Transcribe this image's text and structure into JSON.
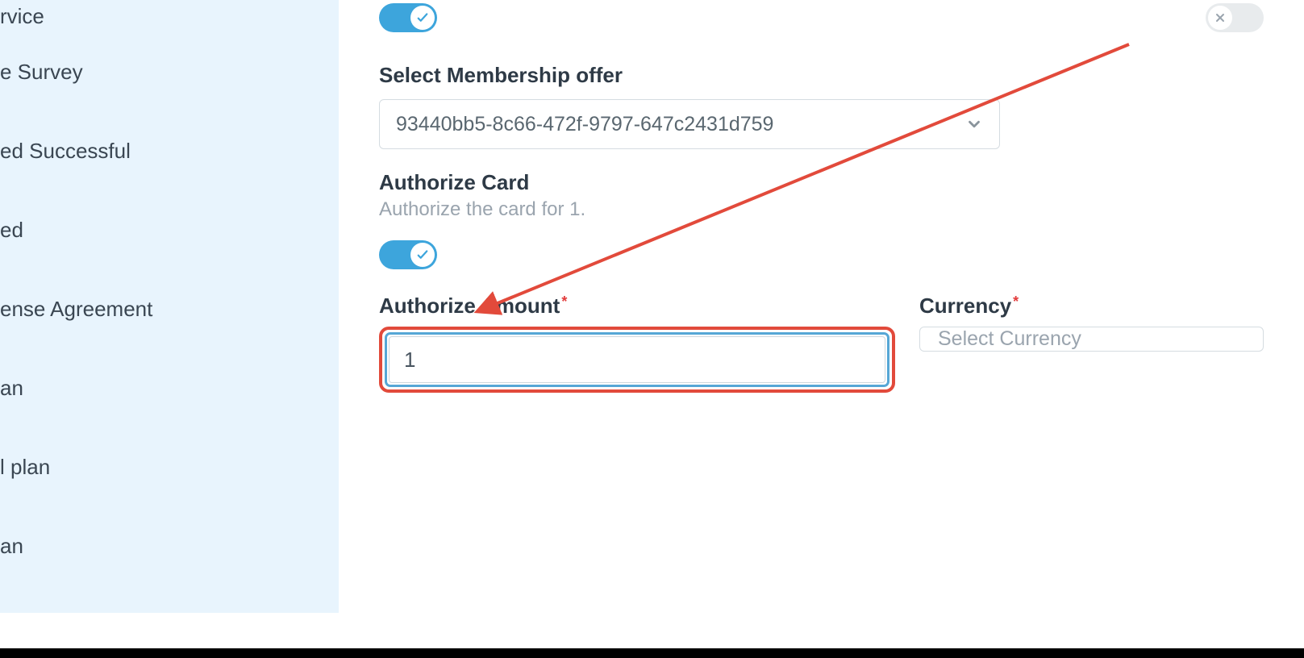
{
  "sidebar": {
    "items": [
      {
        "label": "rvice"
      },
      {
        "label": "e Survey"
      },
      {
        "label": "ed Successful"
      },
      {
        "label": "ed"
      },
      {
        "label": "ense Agreement"
      },
      {
        "label": "an"
      },
      {
        "label": "l plan"
      },
      {
        "label": "an"
      }
    ]
  },
  "form": {
    "top_toggle": {
      "on": true,
      "icon": "check"
    },
    "right_toggle": {
      "on": false,
      "icon": "x"
    },
    "membership": {
      "label": "Select Membership offer",
      "value": "93440bb5-8c66-472f-9797-647c2431d759"
    },
    "authorize_card": {
      "title": "Authorize Card",
      "subtitle": "Authorize the card for 1.",
      "toggle_on": true
    },
    "authorize_amount": {
      "label": "Authorize Amount",
      "value": "1"
    },
    "currency": {
      "label": "Currency",
      "placeholder": "Select Currency"
    }
  },
  "annotation": {
    "arrow_color": "#e24a3b"
  }
}
